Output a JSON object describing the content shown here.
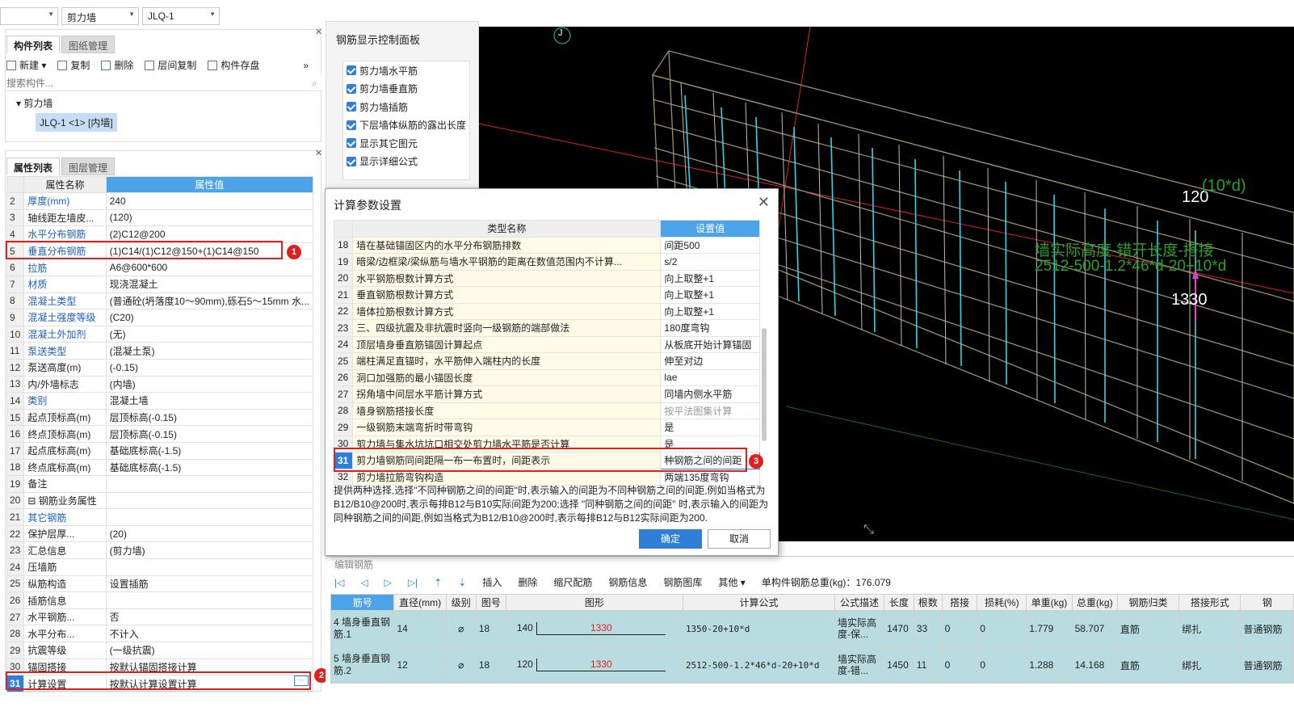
{
  "toolbar": {
    "combo1": "",
    "combo2": "剪力墙",
    "combo3": "JLQ-1"
  },
  "component_panel": {
    "tabs": [
      "构件列表",
      "图纸管理"
    ],
    "actions": [
      "新建",
      "复制",
      "删除",
      "层间复制",
      "构件存盘"
    ],
    "search_placeholder": "搜索构件...",
    "tree_root": "剪力墙",
    "tree_item": "JLQ-1 <1> [内墙]"
  },
  "property_panel": {
    "tabs": [
      "属性列表",
      "图层管理"
    ],
    "header_name": "属性名称",
    "header_value": "属性值",
    "rows": [
      {
        "n": "2",
        "k": "厚度(mm)",
        "v": "240",
        "blue": true
      },
      {
        "n": "3",
        "k": "轴线距左墙皮...",
        "v": "(120)",
        "blue": false
      },
      {
        "n": "4",
        "k": "水平分布钢筋",
        "v": "(2)C12@200",
        "blue": true
      },
      {
        "n": "5",
        "k": "垂直分布钢筋",
        "v": "(1)C14/(1)C12@150+(1)C14@150",
        "blue": true
      },
      {
        "n": "6",
        "k": "拉筋",
        "v": "A6@600*600",
        "blue": true
      },
      {
        "n": "7",
        "k": "材质",
        "v": "现浇混凝土",
        "blue": true
      },
      {
        "n": "8",
        "k": "混凝土类型",
        "v": "(普通砼(坍落度10～90mm),砾石5～15mm 水...",
        "blue": true
      },
      {
        "n": "9",
        "k": "混凝土强度等级",
        "v": "(C20)",
        "blue": true
      },
      {
        "n": "10",
        "k": "混凝土外加剂",
        "v": "(无)",
        "blue": true
      },
      {
        "n": "11",
        "k": "泵送类型",
        "v": "(混凝土泵)",
        "blue": true
      },
      {
        "n": "12",
        "k": "泵送高度(m)",
        "v": "(-0.15)",
        "blue": false
      },
      {
        "n": "13",
        "k": "内/外墙标志",
        "v": "(内墙)",
        "blue": false
      },
      {
        "n": "14",
        "k": "类别",
        "v": "混凝土墙",
        "blue": true
      },
      {
        "n": "15",
        "k": "起点顶标高(m)",
        "v": "层顶标高(-0.15)",
        "blue": false
      },
      {
        "n": "16",
        "k": "终点顶标高(m)",
        "v": "层顶标高(-0.15)",
        "blue": false
      },
      {
        "n": "17",
        "k": "起点底标高(m)",
        "v": "基础底标高(-1.5)",
        "blue": false
      },
      {
        "n": "18",
        "k": "终点底标高(m)",
        "v": "基础底标高(-1.5)",
        "blue": false
      },
      {
        "n": "19",
        "k": "备注",
        "v": "",
        "blue": false
      },
      {
        "n": "20",
        "k": "⊟ 钢筋业务属性",
        "v": "",
        "blue": false
      },
      {
        "n": "21",
        "k": "    其它钢筋",
        "v": "",
        "blue": true
      },
      {
        "n": "22",
        "k": "    保护层厚...",
        "v": "(20)",
        "blue": false
      },
      {
        "n": "23",
        "k": "    汇总信息",
        "v": "(剪力墙)",
        "blue": false
      },
      {
        "n": "24",
        "k": "    压墙筋",
        "v": "",
        "blue": false
      },
      {
        "n": "25",
        "k": "    纵筋构造",
        "v": "设置插筋",
        "blue": false
      },
      {
        "n": "26",
        "k": "    插筋信息",
        "v": "",
        "blue": false
      },
      {
        "n": "27",
        "k": "    水平钢筋...",
        "v": "否",
        "blue": false
      },
      {
        "n": "28",
        "k": "    水平分布...",
        "v": "不计入",
        "blue": false
      },
      {
        "n": "29",
        "k": "    抗震等级",
        "v": "(一级抗震)",
        "blue": false
      },
      {
        "n": "30",
        "k": "    锚固搭接",
        "v": "按默认锚固搭接计算",
        "blue": false
      },
      {
        "n": "31",
        "k": "    计算设置",
        "v": "按默认计算设置计算",
        "blue": false
      }
    ]
  },
  "rebar_display_panel": {
    "title": "钢筋显示控制面板",
    "items": [
      "剪力墙水平筋",
      "剪力墙垂直筋",
      "剪力墙插筋",
      "下层墙体纵筋的露出长度",
      "显示其它图元",
      "显示详细公式"
    ]
  },
  "viewport": {
    "axis_label": "J",
    "label_120": "120",
    "label_10d": "(10*d)",
    "label_1330": "1330",
    "green_line1": "墙实际高度-错开长度-搭接",
    "green_line2": "2512-500-1.2*46*d-20+10*d"
  },
  "calc_dialog": {
    "title": "计算参数设置",
    "header_type": "类型名称",
    "header_value": "设置值",
    "rows": [
      {
        "n": "18",
        "t": "墙在基础锚固区内的水平分布钢筋排数",
        "v": "间距500"
      },
      {
        "n": "19",
        "t": "暗梁/边框梁/梁纵筋与墙水平钢筋的距离在数值范围内不计算...",
        "v": "s/2"
      },
      {
        "n": "20",
        "t": "水平钢筋根数计算方式",
        "v": "向上取整+1"
      },
      {
        "n": "21",
        "t": "垂直钢筋根数计算方式",
        "v": "向上取整+1"
      },
      {
        "n": "22",
        "t": "墙体拉筋根数计算方式",
        "v": "向上取整+1"
      },
      {
        "n": "23",
        "t": "三、四级抗震及非抗震时竖向一级钢筋的端部做法",
        "v": "180度弯钩"
      },
      {
        "n": "24",
        "t": "顶层墙身垂直筋锚固计算起点",
        "v": "从板底开始计算锚固"
      },
      {
        "n": "25",
        "t": "端柱满足直锚时，水平筋伸入端柱内的长度",
        "v": "伸至对边"
      },
      {
        "n": "26",
        "t": "洞口加强筋的最小锚固长度",
        "v": "lae"
      },
      {
        "n": "27",
        "t": "拐角墙中间层水平筋计算方式",
        "v": "同墙内侧水平筋"
      },
      {
        "n": "28",
        "t": "墙身钢筋搭接长度",
        "v": "按平法图集计算"
      },
      {
        "n": "29",
        "t": "一级钢筋末端弯折时带弯钩",
        "v": "是"
      },
      {
        "n": "30",
        "t": "剪力墙与集水坑坑口相交处剪力墙水平筋是否计算",
        "v": "是"
      },
      {
        "n": "31",
        "t": "剪力墙钢筋同间距隔一布一布置时，间距表示",
        "v": "种钢筋之间的间距"
      },
      {
        "n": "32",
        "t": "剪力墙拉筋弯钩构造",
        "v": "两端135度弯钩"
      }
    ],
    "description": "提供两种选择,选择\"不同种钢筋之间的间距\"时,表示输入的间距为不同种钢筋之间的间距,例如当格式为B12/B10@200时,表示每排B12与B10实际间距为200;选择 \"同种钢筋之间的间距\" 时,表示输入的间距为同种钢筋之间的间距,例如当格式为B12/B10@200时,表示每排B12与B12实际间距为200.",
    "ok": "确定",
    "cancel": "取消"
  },
  "badges": [
    "1",
    "2",
    "3"
  ],
  "edit_rebar": {
    "title": "编辑钢筋",
    "toolbar": [
      "插入",
      "删除",
      "缩尺配筋",
      "钢筋信息",
      "钢筋图库",
      "其他"
    ],
    "total": "单构件钢筋总重(kg)：176.079",
    "headers": [
      "筋号",
      "直径(mm)",
      "级别",
      "图号",
      "图形",
      "计算公式",
      "公式描述",
      "长度",
      "根数",
      "搭接",
      "损耗(%)",
      "单重(kg)",
      "总重(kg)",
      "钢筋归类",
      "搭接形式",
      "钢"
    ],
    "rows": [
      {
        "n": "4",
        "name": "墙身垂直钢筋.1",
        "dia": "14",
        "grade": "⌀",
        "fig": "18",
        "s1": "140",
        "s2": "1330",
        "formula": "1350-20+10*d",
        "desc": "墙实际高度-保...",
        "len": "1470",
        "count": "33",
        "lap": "0",
        "loss": "0",
        "unit": "1.779",
        "total": "58.707",
        "cat": "直筋",
        "lapform": "绑扎",
        "type": "普通钢筋"
      },
      {
        "n": "5",
        "name": "墙身垂直钢筋.2",
        "dia": "12",
        "grade": "⌀",
        "fig": "18",
        "s1": "120",
        "s2": "1330",
        "formula": "2512-500-1.2*46*d-20+10*d",
        "desc": "墙实际高度-错...",
        "len": "1450",
        "count": "11",
        "lap": "0",
        "loss": "0",
        "unit": "1.288",
        "total": "14.168",
        "cat": "直筋",
        "lapform": "绑扎",
        "type": "普通钢筋"
      }
    ]
  }
}
